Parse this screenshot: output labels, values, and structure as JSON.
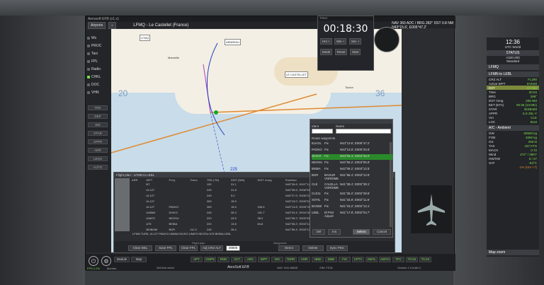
{
  "window": {
    "title": "Aerosoft EFB (v1.x)",
    "location": "LFMQ - Le Castellet (France)",
    "nav": "NAV 360 ADC / BRG 282° DST 0.8 NM",
    "coord": "N43°15.6', E005°47.2'"
  },
  "toolbar": {
    "airports_label": "Airports",
    "home_icon": "house-icon"
  },
  "sidebar": {
    "items": [
      {
        "label": "Wx",
        "on": false
      },
      {
        "label": "PROC",
        "on": false
      },
      {
        "label": "Taxi",
        "on": false
      },
      {
        "label": "FPL",
        "on": false
      },
      {
        "label": "Radio",
        "on": false
      },
      {
        "label": "CHKL",
        "on": true
      },
      {
        "label": "DOC",
        "on": false
      },
      {
        "label": "VHN",
        "on": false
      }
    ],
    "buttons": [
      "TRK",
      "DEP",
      "SID",
      "STAR",
      "APPR",
      "ARR",
      "LEGS",
      "AUTO"
    ]
  },
  "map": {
    "labels": [
      {
        "text": "LFMQ",
        "k": "a"
      },
      {
        "text": "CASTELLET",
        "k": "b"
      },
      {
        "text": "Marseille",
        "k": "c"
      },
      {
        "text": "Toulon",
        "k": "d"
      },
      {
        "text": "LE CASTELLET",
        "k": "e"
      },
      {
        "text": "ABNBEAU",
        "k": "f"
      }
    ],
    "range_labels": [
      "20",
      "36"
    ],
    "heading_labels": [
      "225",
      "23"
    ]
  },
  "timer": {
    "title": "Timer",
    "time": "00:18:30",
    "buttons_top": [
      "Hrs +",
      "Min +",
      "Sec +"
    ],
    "buttons_bot": [
      "Mode",
      "Reset",
      "Start"
    ]
  },
  "right_panel": {
    "utc": "12:36",
    "utc_label": "UTC World",
    "status": "STATUS",
    "alt_label": "A320-200",
    "alt_label2": "Standard",
    "lfmq": "LFMQ",
    "route_title": "LFMN to LEBL",
    "rows": [
      {
        "k": "CRZ ALT",
        "v": "FL290"
      },
      {
        "k": "Active WPT",
        "v": "EVKIM"
      },
      {
        "k": "DST",
        "v": "4.9 NM"
      },
      {
        "k": "Time",
        "v": "00:04"
      },
      {
        "k": "BRG",
        "v": "288°"
      },
      {
        "k": "DST rmng",
        "v": "206 NM"
      },
      {
        "k": "EET (ETA)",
        "v": "00:35 (13:09z)"
      },
      {
        "k": "STAR",
        "v": "BISBI4M"
      },
      {
        "k": "APPR",
        "v": "ILS 25L-Y"
      },
      {
        "k": "VIA",
        "v": "CLE"
      },
      {
        "k": "LOC",
        "v": "BLM"
      }
    ],
    "ambient_title": "A/C - Ambient",
    "amb_rows": [
      {
        "k": "GW",
        "v": "60500 kg"
      },
      {
        "k": "FOB",
        "v": "4060 kg"
      },
      {
        "k": "GS",
        "v": "255 kt"
      },
      {
        "k": "TAS",
        "v": "437 KTS"
      },
      {
        "k": "MACH",
        "v": "0.72"
      },
      {
        "k": "Wind",
        "v": "272° / 28KT"
      },
      {
        "k": "HW/XW",
        "v": "6 / 27"
      },
      {
        "k": "SAT",
        "v": "-53°C"
      }
    ],
    "isa": "-1% (ISA +7)",
    "map_zoom": "Map zoom"
  },
  "flight_plan": {
    "title": "Flight plan - LFMN to LEBL",
    "headers": [
      "ARR",
      "WPT",
      "Freq",
      "Trans",
      "TRK [°M]",
      "DIST [NM]",
      "DIST rmng",
      "Position",
      "ACT [ft]",
      "Wind/Spd [KTS]"
    ],
    "rows": [
      [
        "",
        "BT",
        "",
        "",
        "192",
        "31.1",
        "",
        "N43°39.6', E007°12.5'",
        "",
        ""
      ],
      [
        "",
        "UL127",
        "",
        "",
        "249",
        "31.8",
        "",
        "N43°35.6', E006°55.8'",
        "",
        ""
      ],
      [
        "",
        "UL127",
        "",
        "",
        "249",
        "5.0",
        "",
        "N43°27.5', E006°24.6'",
        "",
        ""
      ],
      [
        "",
        "UL127",
        "",
        "",
        "269",
        "15.5",
        "",
        "N43°15.0', E005°54.1'",
        "",
        ""
      ],
      [
        "",
        "UL127",
        "PADKO",
        "",
        "269",
        "15.5",
        "206.5",
        "N43°13.8', E005°26.6'",
        "",
        ""
      ],
      [
        "",
        "UM864",
        "DIVKO",
        "",
        "245",
        "26.3",
        "161.7",
        "N43°03.4', E004°46.0'",
        "",
        ""
      ],
      [
        "",
        "UN870",
        "NEOSU",
        "",
        "220",
        "43.5",
        "98.2",
        "N42°55.2', E003°55.8'",
        "",
        ""
      ],
      [
        "",
        "A75",
        "BISBA",
        "",
        "220",
        "13.8",
        "84.8",
        "N42°05.2', E003°12.5'",
        "",
        ""
      ],
      [
        "",
        "BISBI4M",
        "BGR",
        "112.2",
        "245",
        "28.4",
        "",
        "N41°56.4', E003°12.5'",
        "",
        ""
      ]
    ],
    "route_string": "LFMN TURIL UL127 PADKO UM864 DIVKO UN870 NEOSU A75 BISBA LEBL",
    "buttons": [
      "Clear DEL",
      "Save FPL",
      "Clear FPL",
      "Adj CRZ ALT",
      "29000",
      "Direct",
      "Delete",
      "Sync PDC"
    ],
    "section_labels": [
      "Flight plan",
      "Waypoints"
    ]
  },
  "dialog": {
    "ident_label": "Ident",
    "name_label": "Name",
    "route_label": "Route waypoints",
    "waypoints": [
      [
        "ELKOL",
        "Fix",
        "N43°13.6', E005°47.2'"
      ],
      [
        "PADKO",
        "Fix",
        "N43°13.8', E005°26.6'"
      ],
      [
        "DIVKO",
        "Fix",
        "N43°03.4', E004°46.0'"
      ],
      [
        "NEOSU",
        "Fix",
        "N42°55.2', E003°55.8'"
      ],
      [
        "BISBA",
        "Fix",
        "N42°05.2', E003°12.5'"
      ],
      [
        "BGR",
        "BAGUR VOR/DME",
        "N41°56.4', E003°12.5'"
      ],
      [
        "CLE",
        "CALELLA VOR/DME",
        "N41°38.4', E002°38.1'"
      ],
      [
        "CLE11",
        "Fix",
        "N41°36.2', E002°28.6'"
      ],
      [
        "SOTIL",
        "Fix",
        "N41°34.8', E002°11.6'"
      ],
      [
        "BCN58",
        "Fix",
        "N41°15.2', E002°12.1'"
      ],
      [
        "LEBL",
        "El Prat Airport",
        "N41°17.8', E002°04.7'"
      ]
    ],
    "selected_index": 2,
    "buttons": [
      "Del",
      "Ins",
      "Select",
      "Cancel"
    ]
  },
  "bottom": {
    "keys_row1": [
      "APT",
      "CMPS",
      "RNG",
      "VCT",
      "ARC",
      "WPT",
      "WX",
      "TERR",
      "VOR",
      "NDB",
      "DME",
      "FIX",
      "CPTY",
      "AWYL",
      "AWYH",
      "TFC",
      "TCAS",
      "TCAS"
    ],
    "left_labels": [
      "Module",
      "Map"
    ],
    "fps": "FPS 1.2%",
    "mode": "Monitor",
    "status_left": "N/A first world",
    "brand": "AeroSoft EFB",
    "status_mid": "NAV: N41.88N/E",
    "status_mid2": "SIM: FS2k",
    "status_right": "Version 1.0 build 2"
  }
}
